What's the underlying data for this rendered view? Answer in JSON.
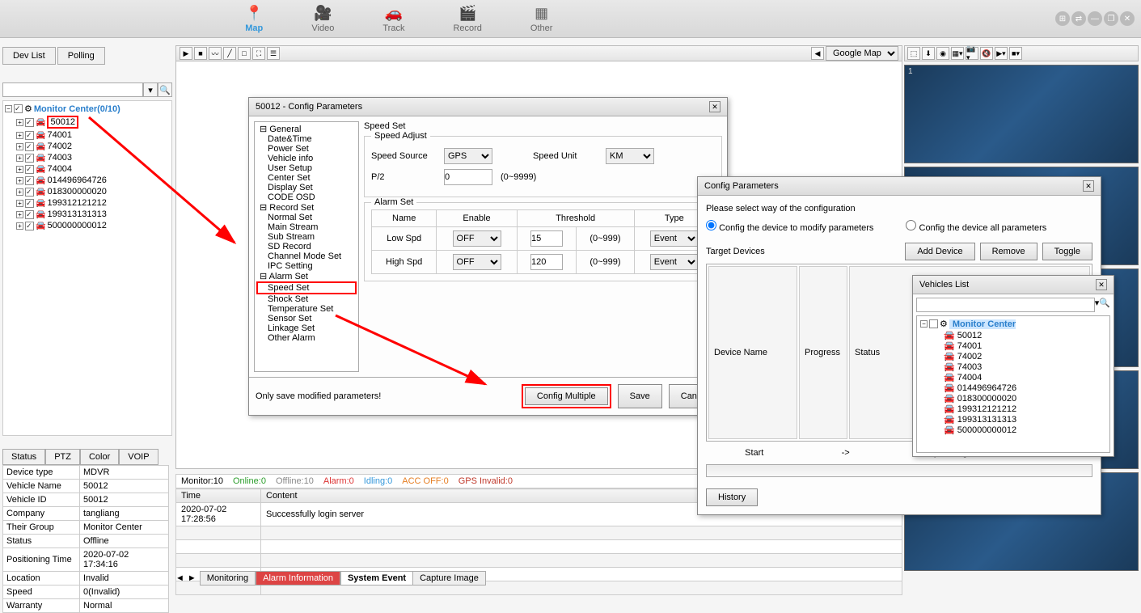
{
  "nav": {
    "map": "Map",
    "video": "Video",
    "track": "Track",
    "record": "Record",
    "other": "Other"
  },
  "left_tabs": {
    "devlist": "Dev List",
    "polling": "Polling"
  },
  "tree_root": "Monitor Center(0/10)",
  "devices": [
    "50012",
    "74001",
    "74002",
    "74003",
    "74004",
    "014496964726",
    "018300000020",
    "199312121212",
    "199313131313",
    "500000000012"
  ],
  "map_provider": "Google Map",
  "info_tabs": [
    "Status",
    "PTZ",
    "Color",
    "VOIP"
  ],
  "info": {
    "device_type_l": "Device type",
    "device_type": "MDVR",
    "vehicle_name_l": "Vehicle Name",
    "vehicle_name": "50012",
    "vehicle_id_l": "Vehicle ID",
    "vehicle_id": "50012",
    "company_l": "Company",
    "company": "tangliang",
    "group_l": "Their Group",
    "group": "Monitor Center",
    "status_l": "Status",
    "status": "Offline",
    "pos_time_l": "Positioning Time",
    "pos_time": "2020-07-02 17:34:16",
    "location_l": "Location",
    "location": "Invalid",
    "speed_l": "Speed",
    "speed": "0(Invalid)",
    "warranty_l": "Warranty",
    "warranty": "Normal"
  },
  "status_bar": {
    "monitor": "Monitor:10",
    "online": "Online:0",
    "offline": "Offline:10",
    "alarm": "Alarm:0",
    "idling": "Idling:0",
    "accoff": "ACC OFF:0",
    "gps": "GPS Invalid:0"
  },
  "log": {
    "time_h": "Time",
    "content_h": "Content",
    "time": "2020-07-02 17:28:56",
    "content": "Successfully login server"
  },
  "bottom_tabs": {
    "monitoring": "Monitoring",
    "alarm": "Alarm Information",
    "sys": "System Event",
    "capture": "Capture Image"
  },
  "cfg": {
    "title": "50012 - Config Parameters",
    "groups": {
      "general": "General",
      "date": "Date&Time",
      "power": "Power Set",
      "vehicle": "Vehicle info",
      "user": "User Setup",
      "center": "Center Set",
      "display": "Display Set",
      "code": "CODE OSD",
      "record": "Record Set",
      "normal": "Normal Set",
      "main": "Main Stream",
      "sub": "Sub Stream",
      "sd": "SD Record",
      "channel": "Channel Mode Set",
      "ipc": "IPC Setting",
      "alarm": "Alarm Set",
      "speed": "Speed Set",
      "shock": "Shock Set",
      "temp": "Temperature Set",
      "sensor": "Sensor Set",
      "linkage": "Linkage Set",
      "other": "Other Alarm"
    },
    "speed_set": "Speed Set",
    "speed_adjust": "Speed Adjust",
    "speed_source_l": "Speed Source",
    "speed_source": "GPS",
    "speed_unit_l": "Speed Unit",
    "speed_unit": "KM",
    "p2_l": "P/2",
    "p2": "0",
    "p2_hint": "(0~9999)",
    "alarm_set": "Alarm Set",
    "th_name": "Name",
    "th_enable": "Enable",
    "th_threshold": "Threshold",
    "th_type": "Type",
    "low_spd": "Low Spd",
    "high_spd": "High Spd",
    "off": "OFF",
    "th_low": "15",
    "th_high": "120",
    "th_hint": "(0~999)",
    "event": "Event",
    "only_save": "Only save modified parameters!",
    "config_multiple": "Config Multiple",
    "save": "Save",
    "cancel": "Cancel"
  },
  "cfg2": {
    "title": "Config Parameters",
    "prompt": "Please select way of the configuration",
    "r1": "Config the device to modify parameters",
    "r2": "Config the device all parameters",
    "target_devices": "Target Devices",
    "add": "Add Device",
    "remove": "Remove",
    "toggle": "Toggle",
    "col_name": "Device Name",
    "col_prog": "Progress",
    "col_status": "Status",
    "start": "Start",
    "uploading": "Uploading",
    "arrow": "->",
    "history": "History"
  },
  "vl": {
    "title": "Vehicles List",
    "root": "Monitor Center",
    "items": [
      "50012",
      "74001",
      "74002",
      "74003",
      "74004",
      "014496964726",
      "018300000020",
      "199312121212",
      "199313131313",
      "500000000012"
    ]
  }
}
